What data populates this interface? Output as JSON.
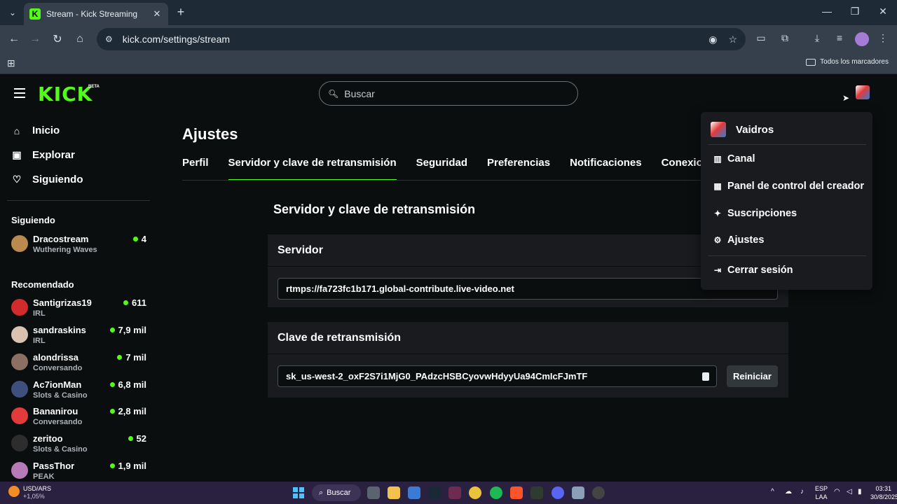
{
  "browser": {
    "tab_title": "Stream - Kick Streaming",
    "tab_close": "✕",
    "new_tab": "+",
    "url": "kick.com/settings/stream",
    "bookmarks_all": "Todos los marcadores",
    "window_controls": [
      "—",
      "❐",
      "✕"
    ]
  },
  "kick": {
    "logo": "KICK",
    "logo_badge": "BETA",
    "search_placeholder": "Buscar",
    "nav": [
      {
        "label": "Inicio",
        "icon": "home-icon"
      },
      {
        "label": "Explorar",
        "icon": "browse-icon"
      },
      {
        "label": "Siguiendo",
        "icon": "heart-icon"
      }
    ],
    "following_heading": "Siguiendo",
    "following": [
      {
        "name": "Dracostream",
        "category": "Wuthering Waves",
        "viewers": "4",
        "avatar_color": "#b9894f"
      }
    ],
    "recommended_heading": "Recomendado",
    "recommended": [
      {
        "name": "Santigrizas19",
        "category": "IRL",
        "viewers": "611",
        "avatar_color": "#d12b2b"
      },
      {
        "name": "sandraskins",
        "category": "IRL",
        "viewers": "7,9 mil",
        "avatar_color": "#d9c2b0"
      },
      {
        "name": "alondrissa",
        "category": "Conversando",
        "viewers": "7 mil",
        "avatar_color": "#8a6f62"
      },
      {
        "name": "Ac7ionMan",
        "category": "Slots & Casino",
        "viewers": "6,8 mil",
        "avatar_color": "#3f4f7d"
      },
      {
        "name": "Bananirou",
        "category": "Conversando",
        "viewers": "2,8 mil",
        "avatar_color": "#e23b3b"
      },
      {
        "name": "zeritoo",
        "category": "Slots & Casino",
        "viewers": "52",
        "avatar_color": "#2d2d2d"
      },
      {
        "name": "PassThor",
        "category": "PEAK",
        "viewers": "1,9 mil",
        "avatar_color": "#b77ab8"
      }
    ],
    "page_title": "Ajustes",
    "tabs": [
      "Perfil",
      "Servidor y clave de retransmisión",
      "Seguridad",
      "Preferencias",
      "Notificaciones",
      "Conexiones"
    ],
    "active_tab": 1,
    "section_title": "Servidor y clave de retransmisión",
    "server": {
      "heading": "Servidor",
      "value": "rtmps://fa723fc1b171.global-contribute.live-video.net"
    },
    "key": {
      "heading": "Clave de retransmisión",
      "value": "sk_us-west-2_oxF2S7i1MjG0_PAdzcHSBCyovwHdyyUa94CmIcFJmTF",
      "reset_label": "Reiniciar"
    },
    "dropdown": {
      "username": "Vaidros",
      "items": [
        {
          "label": "Canal",
          "icon": "channel-icon"
        },
        {
          "label": "Panel de control del creador",
          "icon": "dashboard-icon"
        },
        {
          "label": "Suscripciones",
          "icon": "sparkle-icon"
        },
        {
          "label": "Ajustes",
          "icon": "gear-icon"
        }
      ],
      "logout": "Cerrar sesión"
    },
    "accent": "#53fc18"
  },
  "taskbar": {
    "ticker_name": "USD/ARS",
    "ticker_change": "+1,05%",
    "search_label": "Buscar",
    "lang_line1": "ESP",
    "lang_line2": "LAA",
    "time": "03:31",
    "date": "30/8/2025"
  }
}
